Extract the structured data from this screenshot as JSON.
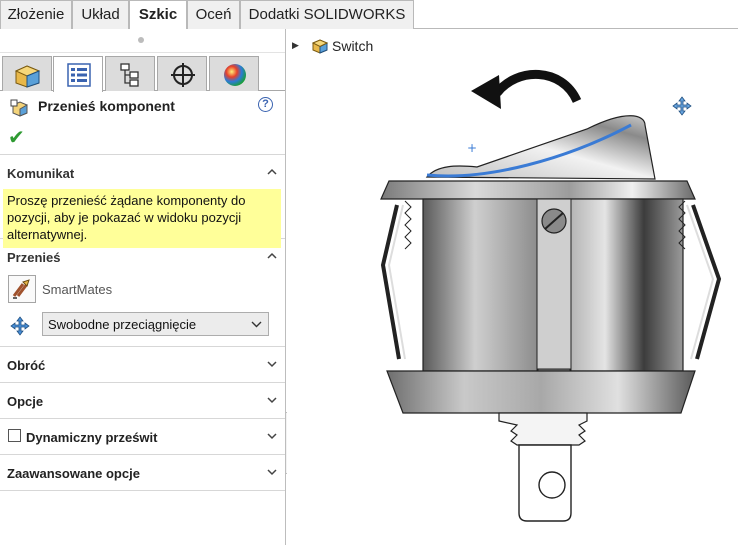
{
  "tabs": [
    {
      "label": "Złożenie",
      "active": false
    },
    {
      "label": "Układ",
      "active": false
    },
    {
      "label": "Szkic",
      "active": true
    },
    {
      "label": "Oceń",
      "active": false
    },
    {
      "label": "Dodatki SOLIDWORKS",
      "active": false
    }
  ],
  "manager_tabs": [
    "featuremanager-icon",
    "propertymanager-icon",
    "configurationmanager-icon",
    "dimxpert-icon",
    "display-manager-icon"
  ],
  "property_manager": {
    "title": "Przenieś komponent",
    "help": "?",
    "ok_symbol": "✔",
    "message": {
      "header": "Komunikat",
      "text": "Proszę przenieść żądane komponenty do pozycji, aby je pokazać w widoku pozycji alternatywnej."
    },
    "move": {
      "header": "Przenieś",
      "smartmates_label": "SmartMates",
      "mode_value": "Swobodne przeciągnięcie"
    },
    "rotate": {
      "header": "Obróć"
    },
    "options": {
      "header": "Opcje"
    },
    "clearance": {
      "header": "Dynamiczny prześwit",
      "checked": false
    },
    "advanced": {
      "header": "Zaawansowane opcje"
    }
  },
  "viewport": {
    "tree_label": "Switch"
  },
  "colors": {
    "message_bg": "#ffff99",
    "accent_blue": "#3a7bd5",
    "ok_green": "#2e9a32"
  }
}
